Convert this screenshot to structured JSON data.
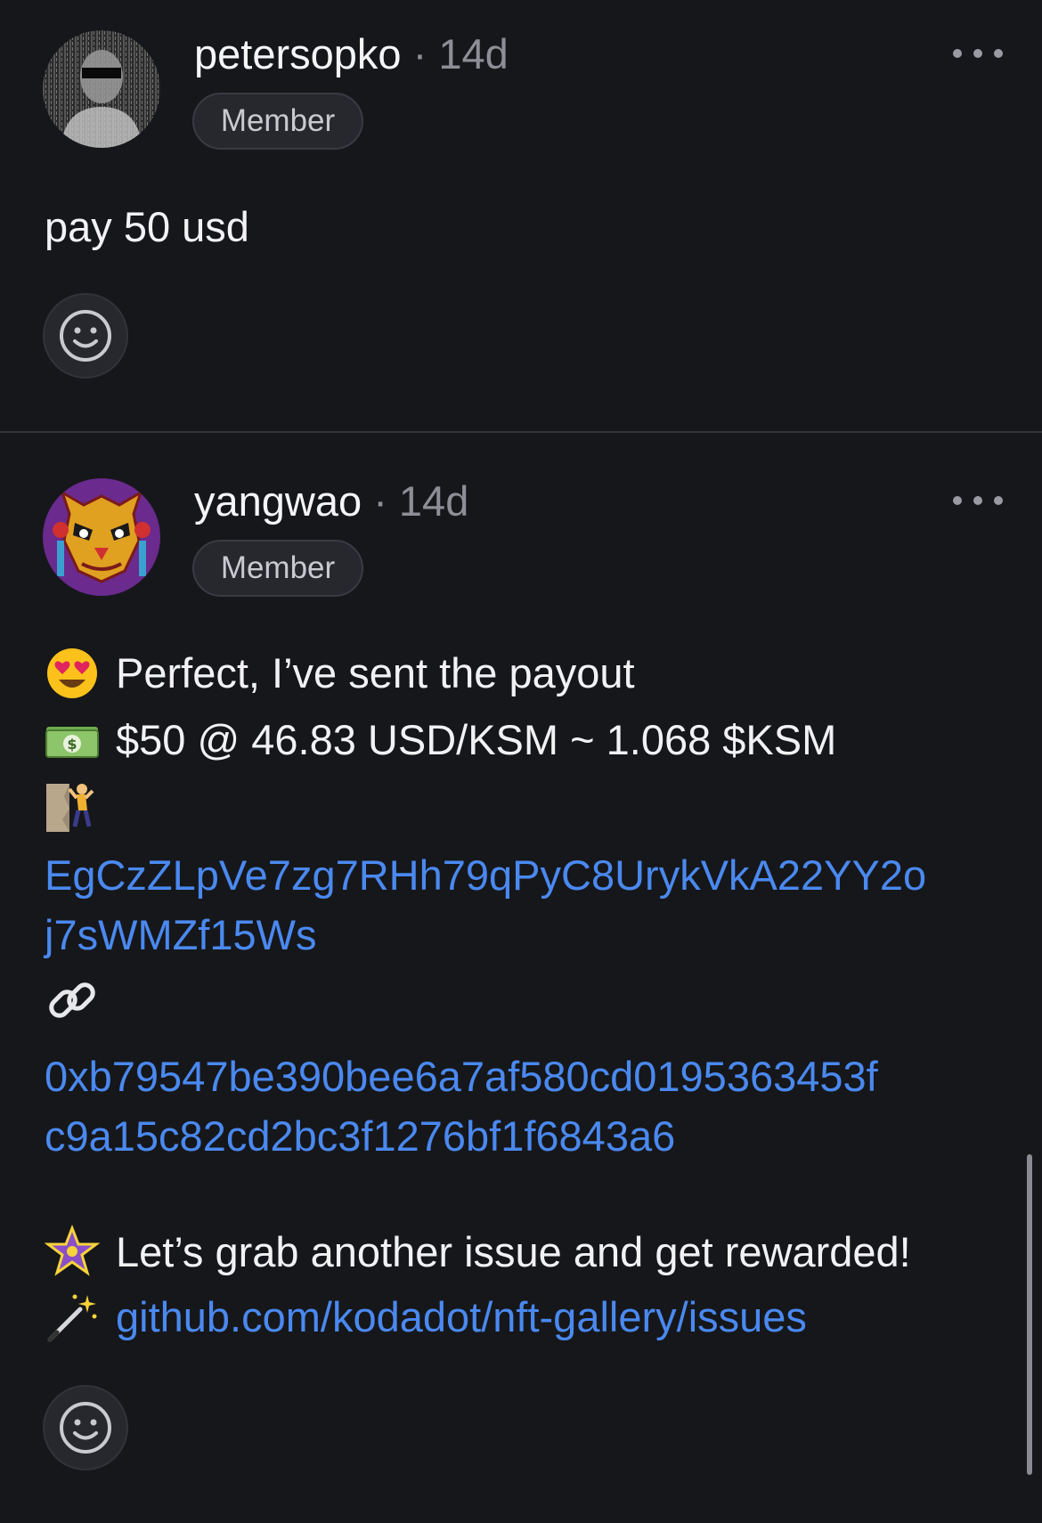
{
  "comments": [
    {
      "username": "petersopko",
      "separator": "·",
      "age": "14d",
      "badge": "Member",
      "avatar_icon": "dark-portrait-avatar",
      "body": "pay 50 usd"
    },
    {
      "username": "yangwao",
      "separator": "·",
      "age": "14d",
      "badge": "Member",
      "avatar_icon": "mask-avatar",
      "lines": {
        "perfect": "Perfect, I’ve sent the payout",
        "amount": "$50 @ 46.83 USD/KSM ~ 1.068 $KSM",
        "address_1": "EgCzZLpVe7zg7RHh79qPyC8UrykVkA22YY2o",
        "address_2": "j7sWMZf15Ws",
        "tx_1": "0xb79547be390bee6a7af580cd0195363453f",
        "tx_2": "c9a15c82cd2bc3f1276bf1f6843a6",
        "grab": "Let’s grab another issue and get rewarded!",
        "issues_link": "github.com/kodadot/nft-gallery/issues"
      },
      "emojis": [
        "heart-eyes-emoji",
        "money-emoji",
        "climber-emoji",
        "link-emoji",
        "star-emoji",
        "magic-wand-emoji"
      ]
    }
  ],
  "colors": {
    "background": "#16171b",
    "link": "#4a89f0",
    "muted": "#8e8f96"
  }
}
